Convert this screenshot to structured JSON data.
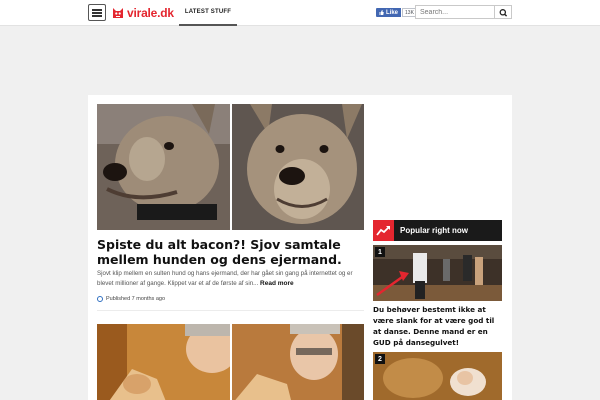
{
  "header": {
    "logo_text": "virale.dk",
    "nav_tab": "Latest stuff",
    "fb_like_label": "Like",
    "fb_like_count": "13K",
    "search_placeholder": "Search..."
  },
  "article": {
    "title": "Spiste du alt bacon?! Sjov samtale mellem hunden og dens ejermand.",
    "excerpt": "Sjovt klip mellem en sulten hund og hans ejermand, der har gået sin gang på internettet og er blevet millioner af gange. Klippet var et af de første af sin...",
    "read_more": "Read more",
    "published": "Published 7 months ago"
  },
  "sidebar": {
    "popular_title": "Popular right now",
    "items": [
      {
        "rank": "1",
        "caption": "Du behøver bestemt ikke at være slank for at være god til at danse. Denne mand er en GUD på dansegulvet!"
      },
      {
        "rank": "2",
        "caption": ""
      }
    ]
  },
  "colors": {
    "brand_red": "#e4262f",
    "facebook_blue": "#4267b2",
    "dark_header": "#1a1a1a"
  }
}
